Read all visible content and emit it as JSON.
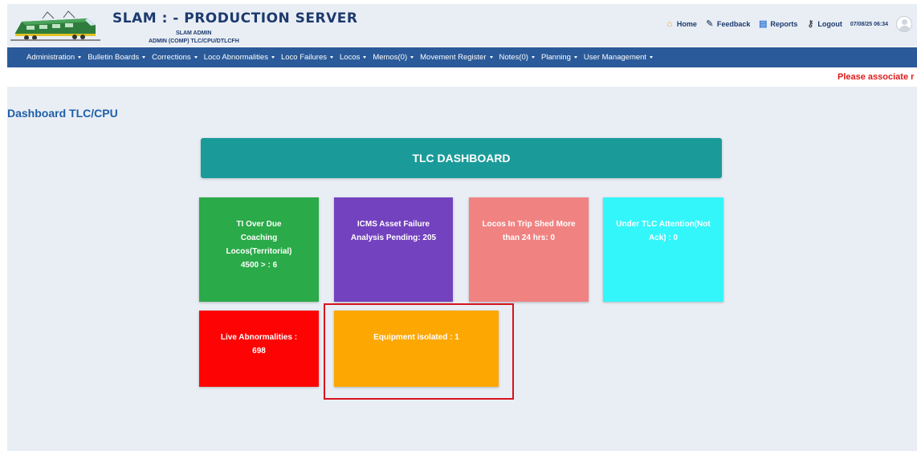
{
  "header": {
    "title": "SLAM : - PRODUCTION SERVER",
    "subtitle_user": "SLAM ADMIN",
    "subtitle_role": "ADMIN (COMP) TLC/CPU/DTLCFH",
    "links": {
      "home": "Home",
      "feedback": "Feedback",
      "reports": "Reports",
      "logout": "Logout"
    },
    "datetime": "07/08/25 06:34"
  },
  "nav": [
    "Administration",
    "Bulletin Boards",
    "Corrections",
    "Loco Abnormalities",
    "Loco Failures",
    "Locos",
    "Memos(0)",
    "Movement Register",
    "Notes(0)",
    "Planning",
    "User Management"
  ],
  "notice": "Please associate r",
  "page_title": "Dashboard TLC/CPU",
  "dashboard": {
    "banner": "TLC DASHBOARD",
    "tiles": [
      "TI Over Due Coaching Locos(Territorial) 4500 > : 6",
      "ICMS Asset Failure Analysis Pending: 205",
      "Locos In Trip Shed More than 24 hrs: 0",
      "Under TLC Attention(Not Ack) : 0",
      "Live Abnormalities : 698",
      "Equipment isolated : 1"
    ]
  },
  "colors": {
    "nav_bg": "#2a5a99",
    "banner": "#1a9b99",
    "tile_green": "#2aaa48",
    "tile_purple": "#7342be",
    "tile_salmon": "#f08382",
    "tile_cyan": "#33f6fb",
    "tile_red": "#fd0303",
    "tile_orange": "#fda702",
    "highlight": "#d6131d"
  },
  "icons": {
    "home": "home-icon",
    "feedback": "feedback-icon",
    "reports": "reports-icon",
    "logout": "key-icon",
    "logo": "locomotive-logo"
  }
}
